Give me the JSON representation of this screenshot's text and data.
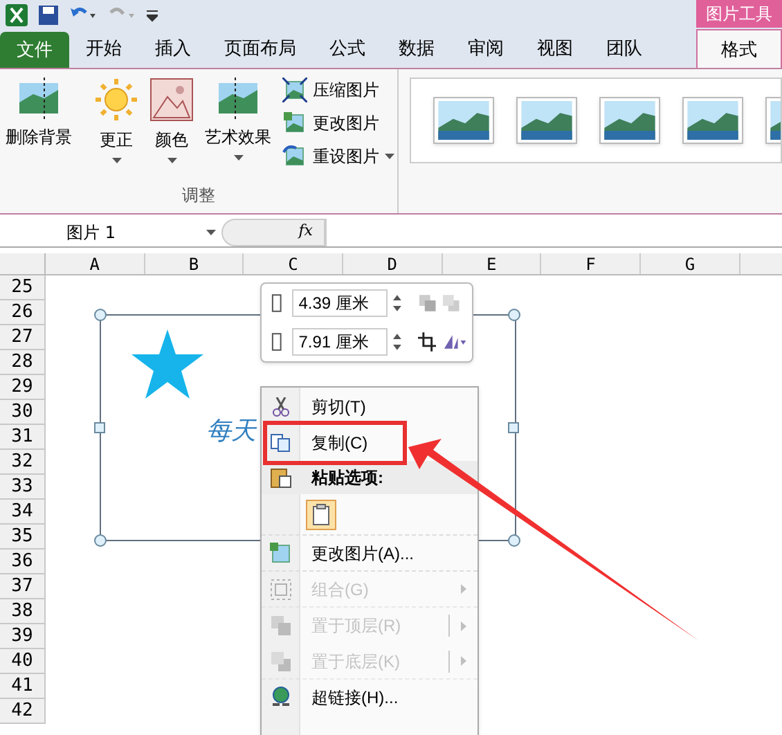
{
  "ribbon": {
    "context_label": "图片工具",
    "tabs": [
      {
        "label": "文件",
        "kind": "file",
        "selected": false
      },
      {
        "label": "开始",
        "kind": "tab",
        "selected": false
      },
      {
        "label": "插入",
        "kind": "tab",
        "selected": false
      },
      {
        "label": "页面布局",
        "kind": "tab",
        "selected": false
      },
      {
        "label": "公式",
        "kind": "tab",
        "selected": false
      },
      {
        "label": "数据",
        "kind": "tab",
        "selected": false
      },
      {
        "label": "审阅",
        "kind": "tab",
        "selected": false
      },
      {
        "label": "视图",
        "kind": "tab",
        "selected": false
      },
      {
        "label": "团队",
        "kind": "tab",
        "selected": false
      },
      {
        "label": "格式",
        "kind": "context",
        "selected": true
      }
    ],
    "group": {
      "title": "调整",
      "large_buttons": [
        {
          "label": "删除背景",
          "kind": "remove",
          "dropdown": false
        },
        {
          "label": "更正",
          "kind": "sun",
          "dropdown": true
        },
        {
          "label": "颜色",
          "kind": "color",
          "dropdown": true
        },
        {
          "label": "艺术效果",
          "kind": "art",
          "dropdown": true
        }
      ],
      "small_buttons": [
        {
          "label": "压缩图片",
          "kind": "compress",
          "dropdown": false
        },
        {
          "label": "更改图片",
          "kind": "change",
          "dropdown": false
        },
        {
          "label": "重设图片",
          "kind": "reset",
          "dropdown": true
        }
      ]
    }
  },
  "name_box": {
    "value": "图片 1"
  },
  "formula_bar": {
    "function_button": "fx"
  },
  "columns": [
    "A",
    "B",
    "C",
    "D",
    "E",
    "F",
    "G"
  ],
  "rows": [
    "25",
    "26",
    "27",
    "28",
    "29",
    "30",
    "31",
    "32",
    "33",
    "34",
    "35",
    "36",
    "37",
    "38",
    "39",
    "40",
    "41",
    "42"
  ],
  "picture": {
    "text": "每天"
  },
  "size_toolbar": {
    "height": "4.39 厘米",
    "width": "7.91 厘米"
  },
  "context_menu": {
    "items": [
      {
        "label": "剪切(T)",
        "kind": "item",
        "disabled": false,
        "submenu": false
      },
      {
        "label": "复制(C)",
        "kind": "item",
        "disabled": false,
        "submenu": false
      },
      {
        "label": "粘贴选项:",
        "kind": "header"
      },
      {
        "kind": "paste_icons"
      },
      {
        "label": "更改图片(A)...",
        "kind": "item",
        "disabled": false,
        "submenu": false
      },
      {
        "label": "组合(G)",
        "kind": "item",
        "disabled": true,
        "submenu": true
      },
      {
        "label": "置于顶层(R)",
        "kind": "split",
        "disabled": true,
        "submenu": true
      },
      {
        "label": "置于底层(K)",
        "kind": "split",
        "disabled": true,
        "submenu": true
      },
      {
        "label": "超链接(H)...",
        "kind": "item",
        "disabled": false,
        "submenu": false
      }
    ]
  }
}
